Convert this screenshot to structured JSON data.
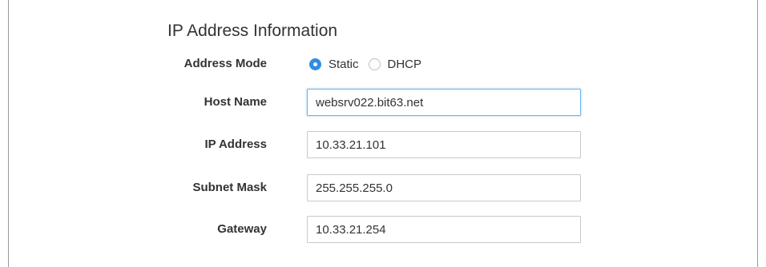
{
  "section": {
    "title": "IP Address Information"
  },
  "address_mode": {
    "label": "Address Mode",
    "options": [
      {
        "label": "Static",
        "checked": true
      },
      {
        "label": "DHCP",
        "checked": false
      }
    ]
  },
  "host_name": {
    "label": "Host Name",
    "value": "websrv022.bit63.net",
    "focused": true
  },
  "ip_address": {
    "label": "IP Address",
    "value": "10.33.21.101"
  },
  "subnet_mask": {
    "label": "Subnet Mask",
    "value": "255.255.255.0"
  },
  "gateway": {
    "label": "Gateway",
    "value": "10.33.21.254"
  },
  "colors": {
    "accent": "#2f8de4",
    "focus_border": "#6fb3e6",
    "input_border": "#c8c8c8",
    "text": "#333333"
  }
}
